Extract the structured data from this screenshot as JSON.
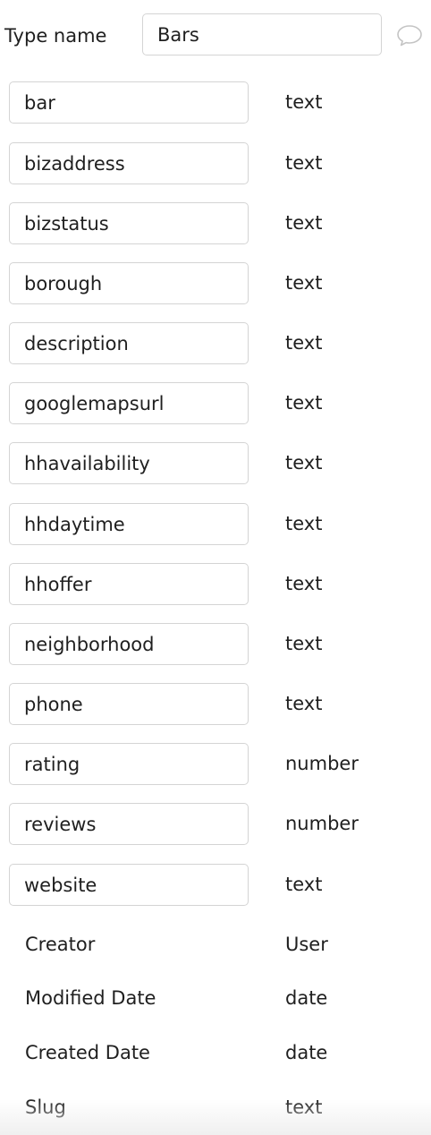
{
  "header": {
    "type_name_label": "Type name",
    "type_name_value": "Bars",
    "comment_icon": "speech-bubble-icon"
  },
  "fields": [
    {
      "name": "bar",
      "type": "text"
    },
    {
      "name": "bizaddress",
      "type": "text"
    },
    {
      "name": "bizstatus",
      "type": "text"
    },
    {
      "name": "borough",
      "type": "text"
    },
    {
      "name": "description",
      "type": "text"
    },
    {
      "name": "googlemapsurl",
      "type": "text"
    },
    {
      "name": "hhavailability",
      "type": "text"
    },
    {
      "name": "hhdaytime",
      "type": "text"
    },
    {
      "name": "hhoffer",
      "type": "text"
    },
    {
      "name": "neighborhood",
      "type": "text"
    },
    {
      "name": "phone",
      "type": "text"
    },
    {
      "name": "rating",
      "type": "number"
    },
    {
      "name": "reviews",
      "type": "number"
    },
    {
      "name": "website",
      "type": "text"
    }
  ],
  "builtin_fields": [
    {
      "name": "Creator",
      "type": "User"
    },
    {
      "name": "Modified Date",
      "type": "date"
    },
    {
      "name": "Created Date",
      "type": "date"
    },
    {
      "name": "Slug",
      "type": "text"
    }
  ]
}
